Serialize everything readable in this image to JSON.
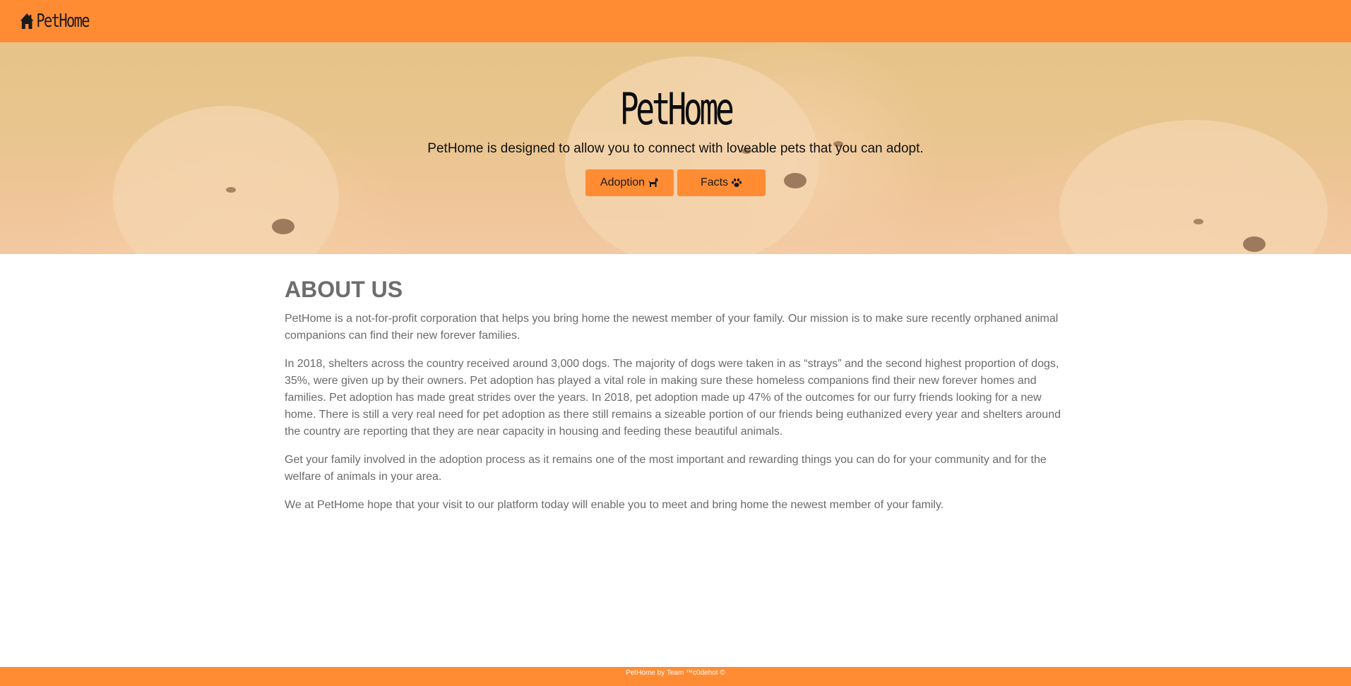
{
  "navbar": {
    "brand": "PetHome",
    "brand_icon": "home-icon",
    "color": "#ff8c33"
  },
  "hero": {
    "title": "PetHome",
    "subtitle": "PetHome is designed to allow you to connect with loveable pets that you can adopt.",
    "buttons": [
      {
        "label": "Adoption",
        "icon": "dog-icon"
      },
      {
        "label": "Facts",
        "icon": "paw-icon"
      }
    ]
  },
  "about": {
    "heading": "ABOUT US",
    "paragraphs": [
      "PetHome is a not-for-profit corporation that helps you bring home the newest member of your family. Our mission is to make sure recently orphaned animal companions can find their new forever families.",
      "In 2018, shelters across the country received around 3,000 dogs. The majority of dogs were taken in as “strays” and the second highest proportion of dogs, 35%, were given up by their owners. Pet adoption has played a vital role in making sure these homeless companions find their new forever homes and families. Pet adoption has made great strides over the years. In 2018, pet adoption made up 47% of the outcomes for our furry friends looking for a new home. There is still a very real need for pet adoption as there still remains a sizeable portion of our friends being euthanized every year and shelters around the country are reporting that they are near capacity in housing and feeding these beautiful animals.",
      "Get your family involved in the adoption process as it remains one of the most important and rewarding things you can do for your community and for the welfare of animals in your area.",
      "We at PetHome hope that your visit to our platform today will enable you to meet and bring home the newest member of your family."
    ]
  },
  "footer": {
    "text": "PetHome by Team ™c0dehot ©"
  }
}
